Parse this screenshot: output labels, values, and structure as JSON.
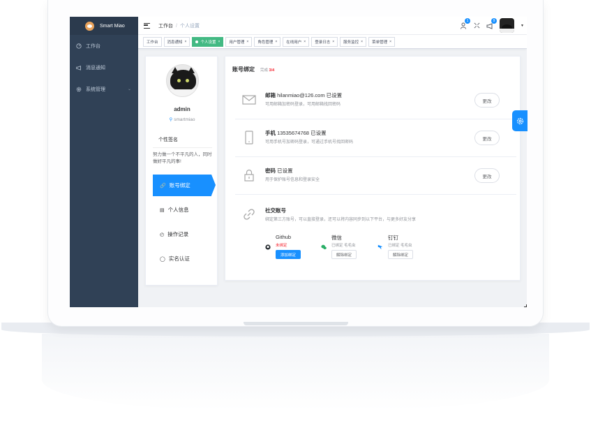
{
  "app": {
    "name": "Smart Miao"
  },
  "sidebar": {
    "items": [
      {
        "label": "工作台",
        "icon": "dashboard-icon"
      },
      {
        "label": "消息通知",
        "icon": "megaphone-icon"
      },
      {
        "label": "系统管理",
        "icon": "gear-icon",
        "has_children": true
      }
    ]
  },
  "breadcrumb": {
    "home": "工作台",
    "separator": "/",
    "current": "个人设置"
  },
  "header": {
    "notify_count": "1",
    "message_count": "9"
  },
  "tabs": [
    {
      "label": "工作台",
      "closable": false,
      "active": false
    },
    {
      "label": "消息通知",
      "closable": true,
      "active": false
    },
    {
      "label": "个人设置",
      "closable": true,
      "active": true
    },
    {
      "label": "用户管理",
      "closable": true,
      "active": false
    },
    {
      "label": "角色管理",
      "closable": true,
      "active": false
    },
    {
      "label": "在线用户",
      "closable": true,
      "active": false
    },
    {
      "label": "登录日志",
      "closable": true,
      "active": false
    },
    {
      "label": "服务监控",
      "closable": true,
      "active": false
    },
    {
      "label": "菜单管理",
      "closable": true,
      "active": false
    }
  ],
  "profile": {
    "name": "admin",
    "account": "smartmiao",
    "signature_title": "个性签名",
    "signature": "努力做一个不平凡的人，同时做好平凡的事!",
    "nav": [
      {
        "label": "账号绑定",
        "icon": "link-icon",
        "active": true
      },
      {
        "label": "个人信息",
        "icon": "id-card-icon",
        "active": false
      },
      {
        "label": "操作记录",
        "icon": "clock-icon",
        "active": false
      },
      {
        "label": "实名认证",
        "icon": "shield-icon",
        "active": false
      }
    ]
  },
  "binding": {
    "title": "账号绑定",
    "progress_label": "完成",
    "progress": "3/4",
    "rows": [
      {
        "title": "邮箱",
        "value": "hilanmiao@126.com",
        "status": "已设置",
        "desc": "可用邮箱加密码登录，可用邮箱找回密码",
        "button": "更改",
        "icon": "mail-icon"
      },
      {
        "title": "手机",
        "value": "13535674768",
        "status": "已设置",
        "desc": "可用手机号加密码登录，可通过手机号找回密码",
        "button": "更改",
        "icon": "phone-icon"
      },
      {
        "title": "密码",
        "value": "",
        "status": "已设置",
        "desc": "用于保护账号信息和登录安全",
        "button": "更改",
        "icon": "lock-icon"
      }
    ],
    "social": {
      "title": "社交账号",
      "desc": "绑定第三方账号，可以直接登录，还可以将内容同步到以下平台，与更多好友分享",
      "accounts": [
        {
          "name": "Github",
          "status": "未绑定",
          "button": "添加绑定",
          "icon": "github-icon",
          "color": "#f5222d"
        },
        {
          "name": "微信",
          "status": "已绑定 毛毛虫",
          "button": "解除绑定",
          "icon": "wechat-icon",
          "color": "#909399"
        },
        {
          "name": "钉钉",
          "status": "已绑定 毛毛虫",
          "button": "解除绑定",
          "icon": "dingtalk-icon",
          "color": "#909399"
        }
      ]
    }
  },
  "colors": {
    "sidebar": "#304156",
    "primary": "#1890ff",
    "tab_active": "#42b983",
    "danger": "#f5222d"
  }
}
